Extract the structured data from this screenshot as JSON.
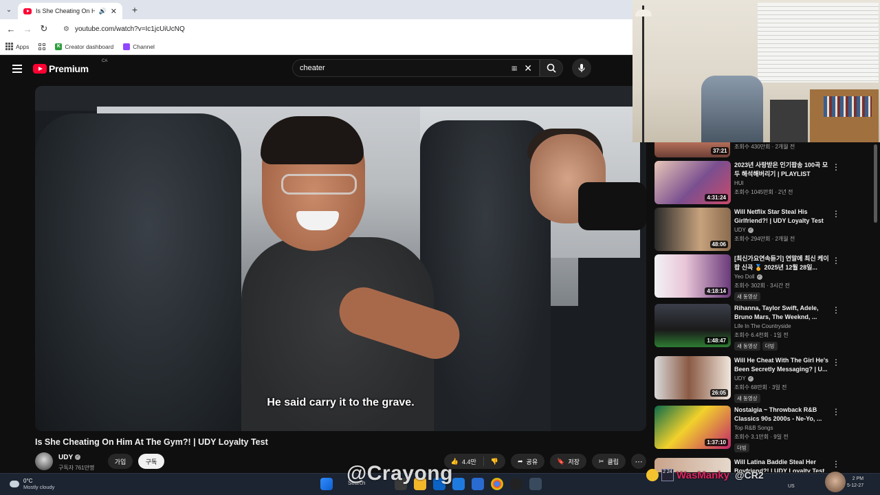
{
  "browser": {
    "tab_title": "Is She Cheating On Him At",
    "url": "youtube.com/watch?v=Ic1jcUiUcNQ",
    "bookmarks": [
      {
        "label": "Apps"
      },
      {
        "label": "Creator dashboard"
      },
      {
        "label": "Channel"
      }
    ]
  },
  "youtube": {
    "logo_text": "Premium",
    "region": "CA",
    "search_value": "cheater"
  },
  "video": {
    "caption": "He said carry it to the grave.",
    "title": "Is She Cheating On Him At The Gym?! | UDY Loyalty Test",
    "channel": "UDY",
    "subscribers": "구독자 761만명",
    "join_label": "가입",
    "subscribe_label": "구독",
    "likes": "4.4만",
    "share_label": "공유",
    "save_label": "저장",
    "clip_label": "클립"
  },
  "sidebar": {
    "top_item": {
      "duration": "37:21",
      "meta": "조회수 430만회 · 2개월 전"
    },
    "items": [
      {
        "title": "2023년 사랑받은 인기팝송 100곡 모두 해석해버리기 | PLAYLIST",
        "channel": "HUI",
        "meta": "조회수 1045만회 · 2년 전",
        "duration": "4:31:24",
        "badges": []
      },
      {
        "title": "Will Netflix Star Steal His Girlfriend?! | UDY Loyalty Test",
        "channel": "UDY",
        "meta": "조회수 294만회 · 2개월 전",
        "duration": "48:06",
        "badges": []
      },
      {
        "title": "[최신가요연속듣기] 연말에 최신 케이팝 신곡 🏅 2025년 12월 28일...",
        "channel": "Yeo Doll",
        "meta": "조회수 302회 · 3시간 전",
        "duration": "4:18:14",
        "badges": [
          "새 동영상"
        ]
      },
      {
        "title": "Rihanna, Taylor Swift, Adele, Bruno Mars, The Weeknd, ...",
        "channel": "Life In The Countryside",
        "meta": "조회수 6.4천회 · 1일 전",
        "duration": "1:48:47",
        "badges": [
          "새 동영상",
          "더빙"
        ]
      },
      {
        "title": "Will He Cheat With The Girl He's Been Secretly Messaging? | U...",
        "channel": "UDY",
        "meta": "조회수 68만회 · 3일 전",
        "duration": "26:05",
        "badges": [
          "새 동영상"
        ]
      },
      {
        "title": "Nostalgia ~ Throwback R&B Classics 90s 2000s - Ne-Yo, ...",
        "channel": "Top R&B Songs",
        "meta": "조회수 3.1만회 · 9일 전",
        "duration": "1:37:10",
        "badges": [
          "더빙"
        ]
      },
      {
        "title": "Will Latina Baddie Steal Her Boyfriend?! | UDY Loyalty Test",
        "channel": "",
        "meta": "",
        "duration": "",
        "badges": []
      }
    ]
  },
  "taskbar": {
    "temp": "0°C",
    "condition": "Mostly cloudy",
    "search_label": "Search",
    "lang": "US",
    "time": "2 PM",
    "date": "5-12-27"
  },
  "overlay": {
    "watermark": "@Crayong",
    "streamer_name": "WasManky",
    "streamer_tag": "@CR2",
    "badge": "2 24"
  },
  "colors": {
    "youtube_red": "#ff0033",
    "background": "#0f0f0f",
    "streamer_pink": "#e0245e"
  }
}
